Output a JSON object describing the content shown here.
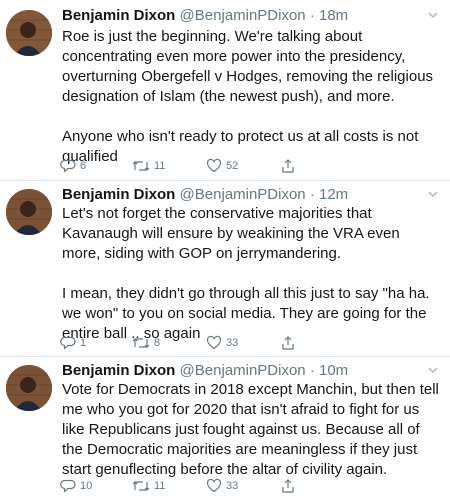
{
  "tweets": [
    {
      "name": "Benjamin Dixon",
      "handle": "@BenjaminPDixon",
      "separator": "·",
      "time": "18m",
      "paragraphs": [
        "Roe is just the beginning. We're talking about concentrating even more power into the presidency, overturning Obergefell v Hodges, removing the religious designation of Islam (the newest push), and more.",
        "Anyone who isn't ready to protect us at all costs is not qualified"
      ],
      "replies": "6",
      "retweets": "11",
      "likes": "52"
    },
    {
      "name": "Benjamin Dixon",
      "handle": "@BenjaminPDixon",
      "separator": "·",
      "time": "12m",
      "paragraphs": [
        "Let's not forget the conservative majorities that Kavanaugh will ensure by weakining the VRA even more, siding with GOP on jerrymandering.",
        "I mean, they didn't go through all this just to say \"ha ha. we won\" to you on social media. They are going for the entire ball .. so again"
      ],
      "replies": "1",
      "retweets": "8",
      "likes": "33"
    },
    {
      "name": "Benjamin Dixon",
      "handle": "@BenjaminPDixon",
      "separator": "·",
      "time": "10m",
      "paragraphs": [
        "Vote for Democrats in 2018 except Manchin, but then tell me who you got for 2020 that isn't afraid to fight for us like Republicans just fought against us. Because all of the Democratic majorities are meaningless if they just start genuflecting before the altar of civility again."
      ],
      "replies": "10",
      "retweets": "11",
      "likes": "33"
    }
  ],
  "icons": {
    "reply": "speech-bubble",
    "retweet": "retweet-arrows",
    "like": "heart-outline",
    "share": "share-upload",
    "menu": "chevron-down"
  },
  "colors": {
    "text": "#14171a",
    "muted": "#657786",
    "icon": "#657786",
    "divider": "#e1e8ed",
    "avatar_bg": "#6b4a33"
  }
}
